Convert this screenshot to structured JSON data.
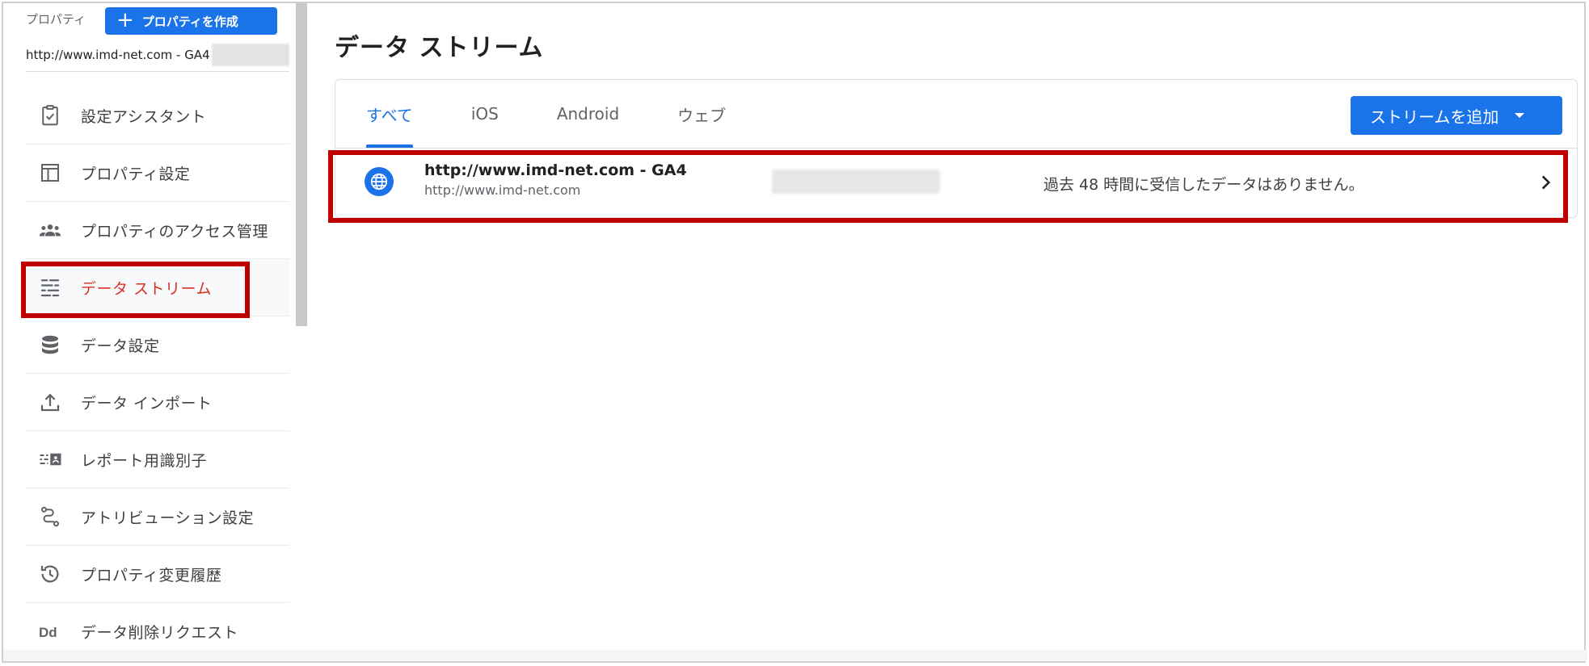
{
  "sidebar": {
    "property_label": "プロパティ",
    "create_button_label": "プロパティを作成",
    "property_url": "http://www.imd-net.com - GA4",
    "items": [
      {
        "label": "設定アシスタント",
        "icon": "clipboard-check-icon"
      },
      {
        "label": "プロパティ設定",
        "icon": "layout-window-icon"
      },
      {
        "label": "プロパティのアクセス管理",
        "icon": "people-icon"
      },
      {
        "label": "データ ストリーム",
        "icon": "stream-lines-icon",
        "active": true
      },
      {
        "label": "データ設定",
        "icon": "database-stack-icon"
      },
      {
        "label": "データ インポート",
        "icon": "upload-icon"
      },
      {
        "label": "レポート用識別子",
        "icon": "identifier-icon"
      },
      {
        "label": "アトリビューション設定",
        "icon": "attribution-path-icon"
      },
      {
        "label": "プロパティ変更履歴",
        "icon": "history-icon"
      },
      {
        "label": "データ削除リクエスト",
        "icon": "dd-delete-icon"
      }
    ]
  },
  "main": {
    "title": "データ ストリーム",
    "tabs": [
      {
        "label": "すべて",
        "active": true
      },
      {
        "label": "iOS"
      },
      {
        "label": "Android"
      },
      {
        "label": "ウェブ"
      }
    ],
    "add_stream_label": "ストリームを追加",
    "stream": {
      "name": "http://www.imd-net.com - GA4",
      "url": "http://www.imd-net.com",
      "status": "過去 48 時間に受信したデータはありません。"
    }
  },
  "colors": {
    "accent": "#1a73e8",
    "active_nav": "#d93025",
    "highlight_box": "#c00000"
  }
}
